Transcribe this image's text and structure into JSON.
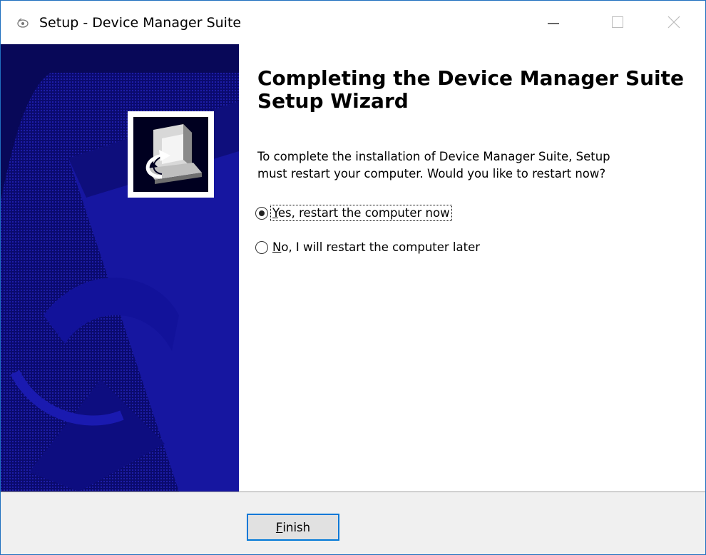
{
  "window": {
    "title": "Setup - Device Manager Suite",
    "controls": {
      "minimize": "minimize-icon",
      "maximize": "maximize-icon",
      "close": "close-icon"
    }
  },
  "wizard": {
    "heading": "Completing the Device Manager Suite Setup Wizard",
    "description": "To complete the installation of Device Manager Suite, Setup\nmust restart your computer. Would you like to restart now?",
    "options": [
      {
        "accel": "Y",
        "rest": "es, restart the computer now",
        "selected": true
      },
      {
        "accel": "N",
        "rest": "o, I will restart the computer later",
        "selected": false
      }
    ]
  },
  "footer": {
    "finish_accel": "F",
    "finish_rest": "inish"
  },
  "colors": {
    "sidebar": "#0a0a6e",
    "sidebar_stripe": "#1c1cb4",
    "accent_border": "#0078d7",
    "footer_bg": "#f0f0f0"
  }
}
